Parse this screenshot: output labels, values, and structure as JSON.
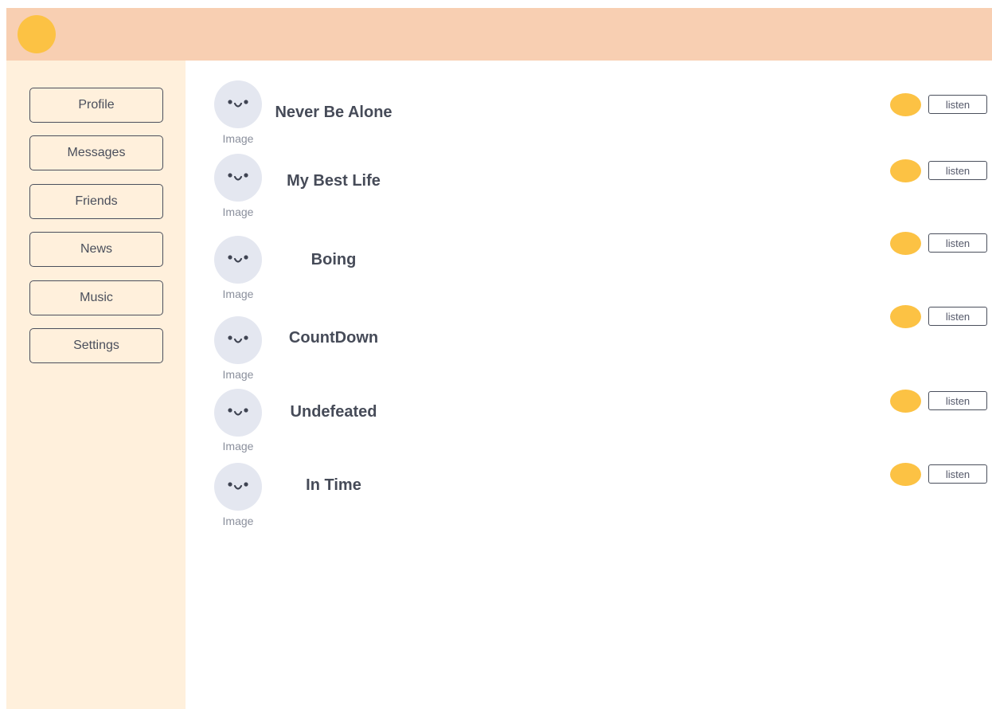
{
  "colors": {
    "header": "#f8cfb2",
    "sidebar": "#fff0dc",
    "accent": "#fcc244",
    "avatar_bg": "#e4e7f0"
  },
  "header": {
    "logo_icon": "yellow-circle-logo"
  },
  "sidebar": {
    "items": [
      {
        "label": "Profile"
      },
      {
        "label": "Messages"
      },
      {
        "label": "Friends"
      },
      {
        "label": "News"
      },
      {
        "label": "Music"
      },
      {
        "label": "Settings"
      }
    ]
  },
  "tracks": [
    {
      "title": "Never Be Alone",
      "image_caption": "Image",
      "action_label": "listen"
    },
    {
      "title": "My Best Life",
      "image_caption": "Image",
      "action_label": "listen"
    },
    {
      "title": "Boing",
      "image_caption": "Image",
      "action_label": "listen"
    },
    {
      "title": "CountDown",
      "image_caption": "Image",
      "action_label": "listen"
    },
    {
      "title": "Undefeated",
      "image_caption": "Image",
      "action_label": "listen"
    },
    {
      "title": "In Time",
      "image_caption": "Image",
      "action_label": "listen"
    }
  ]
}
